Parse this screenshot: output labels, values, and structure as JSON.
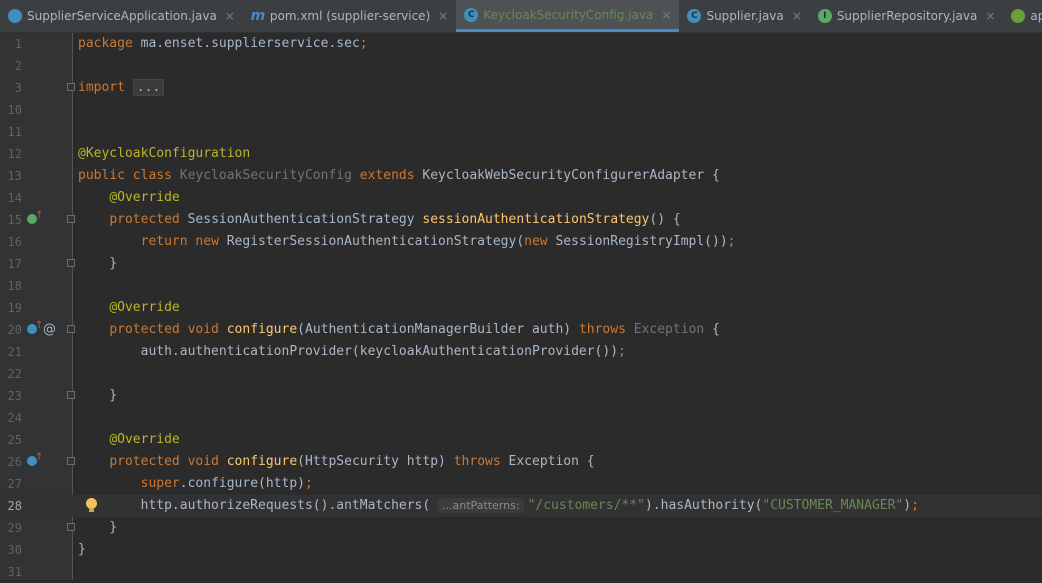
{
  "tabs": [
    {
      "label": "SupplierServiceApplication.java",
      "icon": "run-class-icon"
    },
    {
      "label": "pom.xml (supplier-service)",
      "icon": "maven-icon",
      "glyph": "m"
    },
    {
      "label": "KeycloakSecurityConfig.java",
      "icon": "class-icon",
      "glyph": "C",
      "active": true
    },
    {
      "label": "Supplier.java",
      "icon": "class-icon",
      "glyph": "C"
    },
    {
      "label": "SupplierRepository.java",
      "icon": "interface-icon",
      "glyph": "I"
    },
    {
      "label": "application.properties",
      "icon": "spring-leaf-icon"
    }
  ],
  "tab_close_glyph": "×",
  "colors": {
    "background": "#2b2b2b",
    "keyword": "#cc7832",
    "annotation": "#bbb529",
    "method": "#ffc66d",
    "string": "#6a8759",
    "text": "#a9b7c6"
  },
  "lines": [
    {
      "n": "1",
      "html": "<span class=\"kw\">package</span> ma.enset.supplierservice.sec<span class=\"kw\">;</span>"
    },
    {
      "n": "2",
      "html": ""
    },
    {
      "n": "3",
      "html": "<span class=\"kw\">import</span> <span class=\"fold-text\">...</span>",
      "fold": true
    },
    {
      "n": "10",
      "html": ""
    },
    {
      "n": "11",
      "html": ""
    },
    {
      "n": "12",
      "html": "<span class=\"ann\">@KeycloakConfiguration</span>"
    },
    {
      "n": "13",
      "html": "<span class=\"kw\">public class</span> <span class=\"unused\">KeycloakSecurityConfig</span> <span class=\"kw\">extends</span> KeycloakWebSecurityConfigurerAdapter {"
    },
    {
      "n": "14",
      "html": "    <span class=\"ann\">@Override</span>"
    },
    {
      "n": "15",
      "html": "    <span class=\"kw\">protected</span> SessionAuthenticationStrategy <span class=\"fn\">sessionAuthenticationStrategy</span>() {",
      "mark": "green",
      "fold": true
    },
    {
      "n": "16",
      "html": "        <span class=\"kw\">return new</span> RegisterSessionAuthenticationStrategy(<span class=\"kw\">new</span> SessionRegistryImpl())<span class=\"kw\">;</span>"
    },
    {
      "n": "17",
      "html": "    }",
      "fold": true
    },
    {
      "n": "18",
      "html": ""
    },
    {
      "n": "19",
      "html": "    <span class=\"ann\">@Override</span>"
    },
    {
      "n": "20",
      "html": "    <span class=\"kw\">protected void</span> <span class=\"fn\">configure</span>(AuthenticationManagerBuilder auth) <span class=\"kw\">throws</span> <span class=\"unused\">Exception</span> {",
      "mark": "blue",
      "at": true,
      "fold": true
    },
    {
      "n": "21",
      "html": "        auth.authenticationProvider(keycloakAuthenticationProvider())<span class=\"kw\">;</span>"
    },
    {
      "n": "22",
      "html": ""
    },
    {
      "n": "23",
      "html": "    }",
      "fold": true
    },
    {
      "n": "24",
      "html": ""
    },
    {
      "n": "25",
      "html": "    <span class=\"ann\">@Override</span>"
    },
    {
      "n": "26",
      "html": "    <span class=\"kw\">protected void</span> <span class=\"fn\">configure</span>(HttpSecurity http) <span class=\"kw\">throws</span> Exception {",
      "mark": "blue",
      "fold": true
    },
    {
      "n": "27",
      "html": "        <span class=\"kw\">super</span>.configure(http)<span class=\"kw\">;</span>"
    },
    {
      "n": "28",
      "html": "        http.authorizeRequests().antMatchers( <span class=\"hint\">...antPatterns:</span><span class=\"str\">\"/customers/**\"</span>).hasAuthority(<span class=\"str\">\"CUSTOMER_MANAGER\"</span>)<span class=\"kw\">;</span>",
      "current": true,
      "bulb": true
    },
    {
      "n": "29",
      "html": "    }",
      "fold": true
    },
    {
      "n": "30",
      "html": "}"
    },
    {
      "n": "31",
      "html": ""
    }
  ]
}
